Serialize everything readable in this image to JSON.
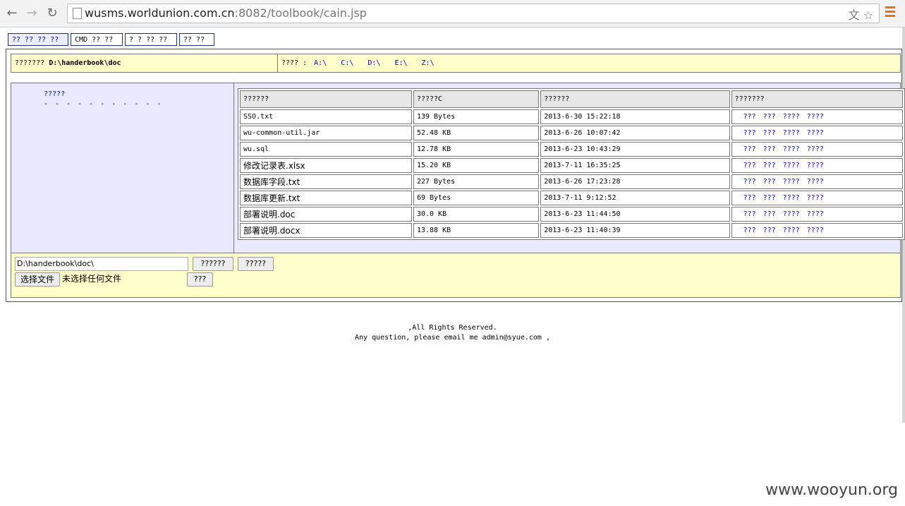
{
  "browser": {
    "url_host": "wusms.worldunion.com.cn",
    "url_rest": ":8082/toolbook/cain.jsp",
    "back_icon": "←",
    "forward_icon": "→",
    "reload_icon": "↻",
    "translate_icon": "文",
    "star_icon": "☆"
  },
  "tabs": [
    "?? ?? ?? ??",
    "CMD ?? ??",
    "? ? ?? ??",
    "?? ??"
  ],
  "pathbar": {
    "label": "???????",
    "current_path": "D:\\handerbook\\doc",
    "drives_label": "???? :",
    "drives": [
      "A:\\",
      "C:\\",
      "D:\\",
      "E:\\",
      "Z:\\"
    ]
  },
  "tree": {
    "root_label": "?????",
    "separator": "- - - - - - - - - - -"
  },
  "file_table": {
    "headers": [
      "??????",
      "?????C",
      "??????",
      "???????"
    ],
    "actions": [
      "???",
      "???",
      "????",
      "????"
    ],
    "rows": [
      {
        "name": "SSO.txt",
        "size": "139 Bytes",
        "modified": "2013-6-30 15:22:18"
      },
      {
        "name": "wu-common-util.jar",
        "size": "52.48 KB",
        "modified": "2013-6-26 10:07:42"
      },
      {
        "name": "wu.sql",
        "size": "12.78 KB",
        "modified": "2013-6-23 10:43:29"
      },
      {
        "name": "修改记录表.xlsx",
        "size": "15.20 KB",
        "modified": "2013-7-11 16:35:25"
      },
      {
        "name": "数据库字段.txt",
        "size": "227 Bytes",
        "modified": "2013-6-26 17:23:28"
      },
      {
        "name": "数据库更新.txt",
        "size": "69 Bytes",
        "modified": "2013-7-11 9:12:52"
      },
      {
        "name": "部署说明.doc",
        "size": "30.0 KB",
        "modified": "2013-6-23 11:44:50"
      },
      {
        "name": "部署说明.docx",
        "size": "13.88 KB",
        "modified": "2013-6-23 11:40:39"
      }
    ]
  },
  "upload": {
    "path_value": "D:\\handerbook\\doc\\",
    "button1": "??????",
    "button2": "?????",
    "choose_file": "选择文件",
    "no_file": "未选择任何文件",
    "submit": "???"
  },
  "footer": {
    "line1": ",All Rights Reserved.",
    "line2": "Any question, please email me admin@syue.com ,"
  },
  "watermark": "www.wooyun.org"
}
